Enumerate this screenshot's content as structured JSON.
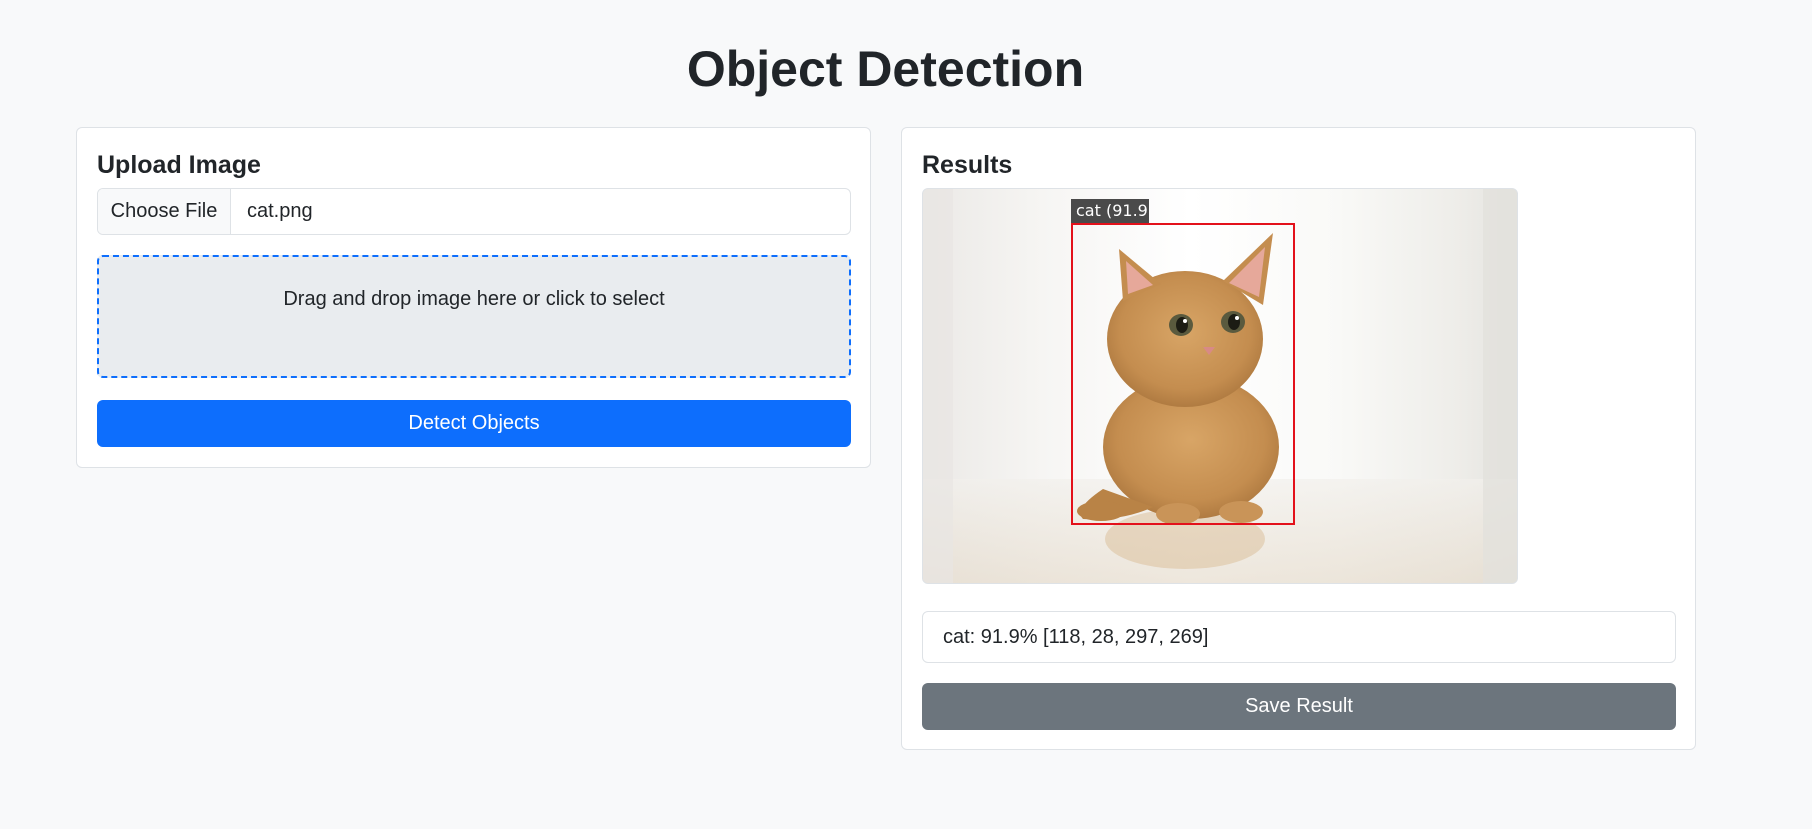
{
  "page": {
    "title": "Object Detection"
  },
  "upload": {
    "title": "Upload Image",
    "choose_file_label": "Choose File",
    "file_name": "cat.png",
    "drop_zone_text": "Drag and drop image here or click to select",
    "detect_button_label": "Detect Objects"
  },
  "results": {
    "title": "Results",
    "detection_label": "cat (91.9",
    "detection_text": "cat: 91.9% [118, 28, 297, 269]",
    "save_button_label": "Save Result"
  },
  "colors": {
    "primary": "#0d6efd",
    "secondary": "#6c757d",
    "bbox": "#e3111b",
    "background": "#f8f9fa"
  }
}
